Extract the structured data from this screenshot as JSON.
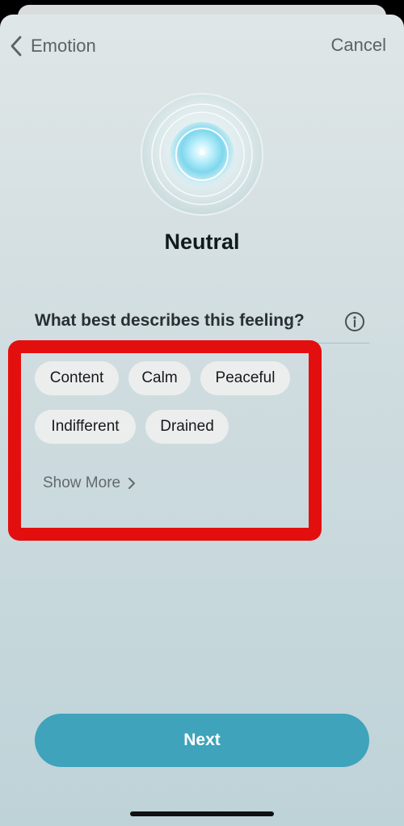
{
  "header": {
    "back_label": "Emotion",
    "cancel_label": "Cancel"
  },
  "emotion": {
    "title": "Neutral"
  },
  "question": {
    "text": "What best describes this feeling?"
  },
  "chips": {
    "items": [
      "Content",
      "Calm",
      "Peaceful",
      "Indifferent",
      "Drained"
    ],
    "show_more_label": "Show More"
  },
  "footer": {
    "next_label": "Next"
  },
  "colors": {
    "accent": "#3ea3bb",
    "highlight": "#e30f0f",
    "chip_bg": "#eceeee"
  },
  "icons": [
    "chevron-left-icon",
    "info-icon",
    "chevron-right-icon",
    "emotion-orb-icon"
  ]
}
